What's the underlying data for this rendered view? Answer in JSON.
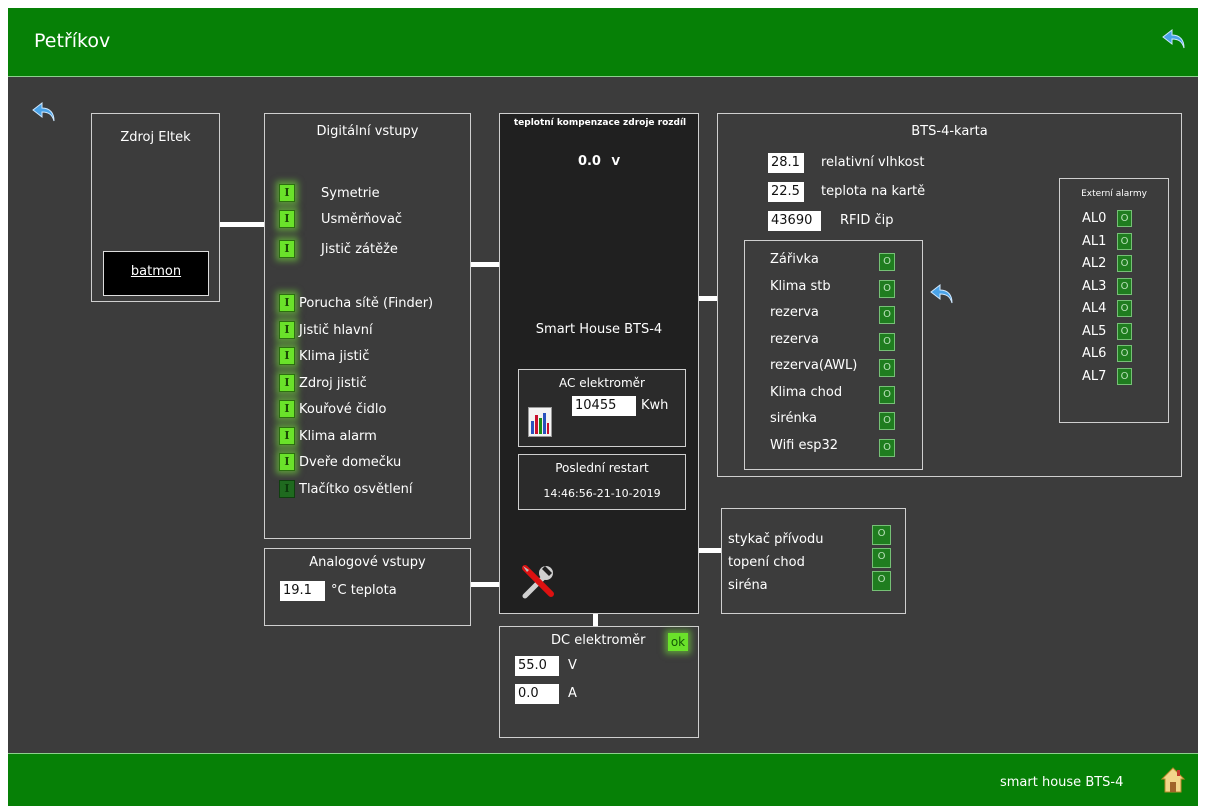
{
  "header": {
    "title": "Petříkov"
  },
  "footer": {
    "label": "smart house BTS-4"
  },
  "zdroj": {
    "title": "Zdroj Eltek",
    "link": "batmon"
  },
  "digital": {
    "title": "Digitální vstupy",
    "group1": [
      {
        "ind": "I",
        "label": "Symetrie"
      },
      {
        "ind": "I",
        "label": "Usměrňovač"
      },
      {
        "ind": "I",
        "label": "Jistič zátěže"
      }
    ],
    "group2": [
      {
        "ind": "I",
        "label": "Porucha sítě (Finder)"
      },
      {
        "ind": "I",
        "label": "Jistič hlavní"
      },
      {
        "ind": "I",
        "label": "Klima jistič"
      },
      {
        "ind": "I",
        "label": "Zdroj jistič"
      },
      {
        "ind": "I",
        "label": "Kouřové čidlo"
      },
      {
        "ind": "I",
        "label": "Klima alarm"
      },
      {
        "ind": "I",
        "label": "Dveře domečku"
      },
      {
        "ind": "I",
        "label": "Tlačítko osvětlení"
      }
    ]
  },
  "analog": {
    "title": "Analogové vstupy",
    "value": "19.1",
    "unit": "°C teplota"
  },
  "center": {
    "komp_title": "teplotní kompenzace zdroje rozdíl",
    "komp_value": "0.0",
    "komp_unit": "V",
    "device": "Smart House BTS-4",
    "ac_title": "AC elektroměr",
    "ac_value": "10455",
    "ac_unit": "Kwh",
    "restart_title": "Poslední restart",
    "restart_value": "14:46:56-21-10-2019"
  },
  "dc": {
    "title": "DC elektroměr",
    "status": "ok",
    "voltage": "55.0",
    "voltage_unit": "V",
    "current": "0.0",
    "current_unit": "A"
  },
  "bts": {
    "title": "BTS-4-karta",
    "rows": [
      {
        "value": "28.1",
        "label": "relativní vlhkost"
      },
      {
        "value": "22.5",
        "label": "teplota na kartě"
      },
      {
        "value": "43690",
        "label": "RFID čip"
      }
    ],
    "outputs": [
      {
        "label": "Zářivka",
        "lamp": "O"
      },
      {
        "label": "Klima stb",
        "lamp": "O"
      },
      {
        "label": "rezerva",
        "lamp": "O"
      },
      {
        "label": "rezerva",
        "lamp": "O"
      },
      {
        "label": "rezerva(AWL)",
        "lamp": "O"
      },
      {
        "label": "Klima chod",
        "lamp": "O"
      },
      {
        "label": "sirénka",
        "lamp": "O"
      },
      {
        "label": "Wifi esp32",
        "lamp": "O"
      }
    ],
    "alarms_title": "Externí alarmy",
    "alarms": [
      {
        "label": "AL0",
        "lamp": "O"
      },
      {
        "label": "AL1",
        "lamp": "O"
      },
      {
        "label": "AL2",
        "lamp": "O"
      },
      {
        "label": "AL3",
        "lamp": "O"
      },
      {
        "label": "AL4",
        "lamp": "O"
      },
      {
        "label": "AL5",
        "lamp": "O"
      },
      {
        "label": "AL6",
        "lamp": "O"
      },
      {
        "label": "AL7",
        "lamp": "O"
      }
    ]
  },
  "relays": [
    {
      "label": "stykač přívodu",
      "lamp": "O"
    },
    {
      "label": "topení chod",
      "lamp": "O"
    },
    {
      "label": "siréna",
      "lamp": "O"
    }
  ],
  "colors": {
    "header_green": "#068006",
    "background": "#3c3c3c",
    "indicator_on": "#6ae22a",
    "lamp_off": "#1f7d1f"
  }
}
